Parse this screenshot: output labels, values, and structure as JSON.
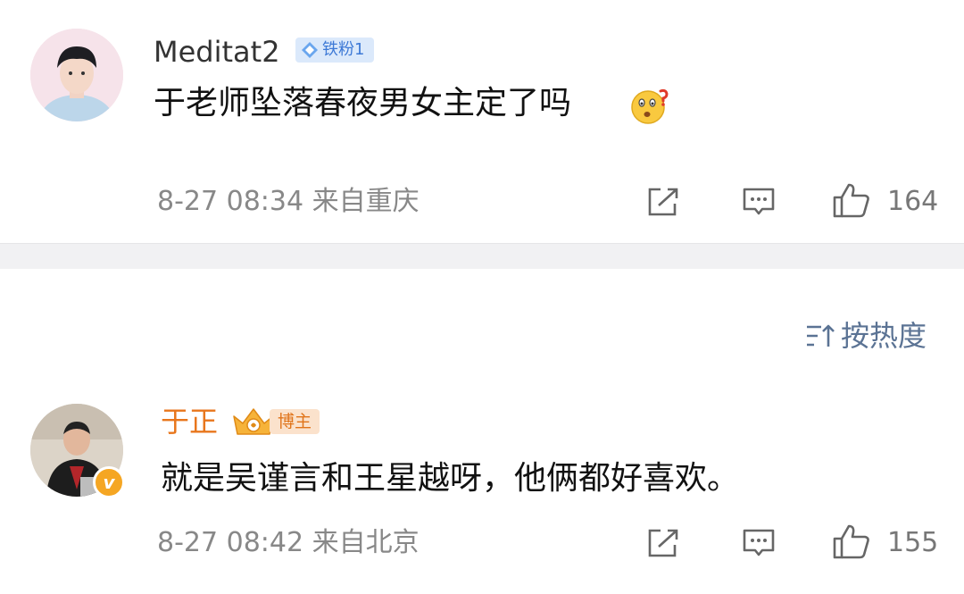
{
  "post": {
    "username": "Meditat2",
    "fan_badge": "铁粉1",
    "text": "于老师坠落春夜男女主定了吗",
    "emoji_icon": "confused-face-icon",
    "meta": "8-27 08:34  来自重庆",
    "like_count": "164"
  },
  "sort": {
    "label": "按热度"
  },
  "comment": {
    "username": "于正",
    "badge": "博主",
    "verified_mark": "v",
    "text": "就是吴谨言和王星越呀，他俩都好喜欢。",
    "meta": "8-27 08:42  来自北京",
    "like_count": "155"
  },
  "colors": {
    "username_blogger": "#e8761c",
    "fan_badge_bg": "#dbe9fb",
    "fan_badge_text": "#3d79d6",
    "sort_text": "#5b7394",
    "meta_text": "#888888",
    "divider": "#f1f1f3"
  }
}
